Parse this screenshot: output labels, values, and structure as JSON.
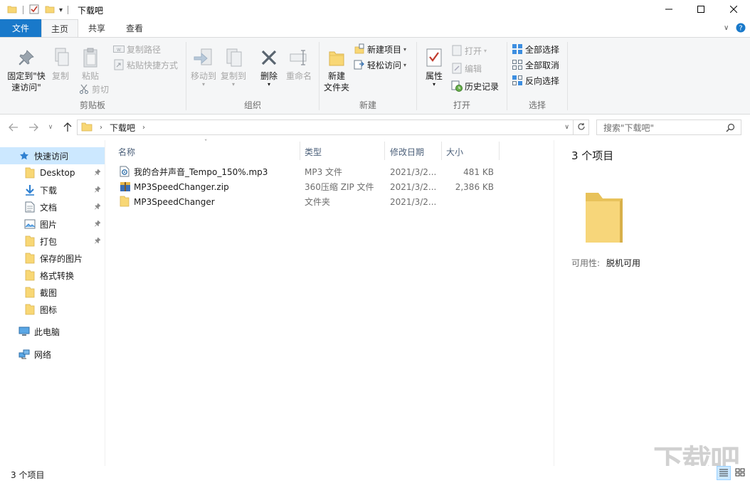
{
  "window": {
    "title": "下载吧",
    "minimize_icon": "minimize-icon",
    "maximize_icon": "maximize-icon",
    "close_icon": "close-icon"
  },
  "tabs": {
    "file": "文件",
    "home": "主页",
    "share": "共享",
    "view": "查看"
  },
  "ribbon": {
    "clipboard": {
      "group": "剪贴板",
      "pin": "固定到\"快\n速访问\"",
      "pin_line1": "固定到\"快",
      "pin_line2": "速访问\"",
      "copy": "复制",
      "paste": "粘贴",
      "copy_path": "复制路径",
      "paste_shortcut": "粘贴快捷方式",
      "cut": "剪切"
    },
    "organize": {
      "group": "组织",
      "move_to": "移动到",
      "copy_to": "复制到",
      "delete": "删除",
      "rename": "重命名"
    },
    "new": {
      "group": "新建",
      "new_folder_l1": "新建",
      "new_folder_l2": "文件夹",
      "new_item": "新建项目",
      "easy_access": "轻松访问"
    },
    "open": {
      "group": "打开",
      "properties": "属性",
      "open": "打开",
      "edit": "编辑",
      "history": "历史记录"
    },
    "select": {
      "group": "选择",
      "select_all": "全部选择",
      "select_none": "全部取消",
      "invert": "反向选择"
    }
  },
  "address": {
    "crumb": "下载吧",
    "search_placeholder": "搜索\"下载吧\""
  },
  "nav": {
    "quick_access": "快速访问",
    "items": [
      {
        "label": "Desktop",
        "icon": "folder-icon",
        "pinned": true
      },
      {
        "label": "下载",
        "icon": "download-icon",
        "pinned": true
      },
      {
        "label": "文档",
        "icon": "document-icon",
        "pinned": true
      },
      {
        "label": "图片",
        "icon": "picture-icon",
        "pinned": true
      },
      {
        "label": "打包",
        "icon": "folder-icon",
        "pinned": true
      },
      {
        "label": "保存的图片",
        "icon": "folder-icon",
        "pinned": false
      },
      {
        "label": "格式转换",
        "icon": "folder-icon",
        "pinned": false
      },
      {
        "label": "截图",
        "icon": "folder-icon",
        "pinned": false
      },
      {
        "label": "图标",
        "icon": "folder-icon",
        "pinned": false
      }
    ],
    "this_pc": "此电脑",
    "network": "网络"
  },
  "columns": {
    "name": "名称",
    "type": "类型",
    "date": "修改日期",
    "size": "大小"
  },
  "files": [
    {
      "name": "我的合并声音_Tempo_150%.mp3",
      "type": "MP3 文件",
      "date": "2021/3/2...",
      "size": "481 KB",
      "icon": "audio-file-icon"
    },
    {
      "name": "MP3SpeedChanger.zip",
      "type": "360压缩 ZIP 文件",
      "date": "2021/3/2...",
      "size": "2,386 KB",
      "icon": "zip-file-icon"
    },
    {
      "name": "MP3SpeedChanger",
      "type": "文件夹",
      "date": "2021/3/2...",
      "size": "",
      "icon": "folder-icon"
    }
  ],
  "details": {
    "count": "3 个项目",
    "availability_label": "可用性:",
    "availability_value": "脱机可用"
  },
  "status": {
    "count": "3 个项目"
  },
  "watermark": "下载吧"
}
